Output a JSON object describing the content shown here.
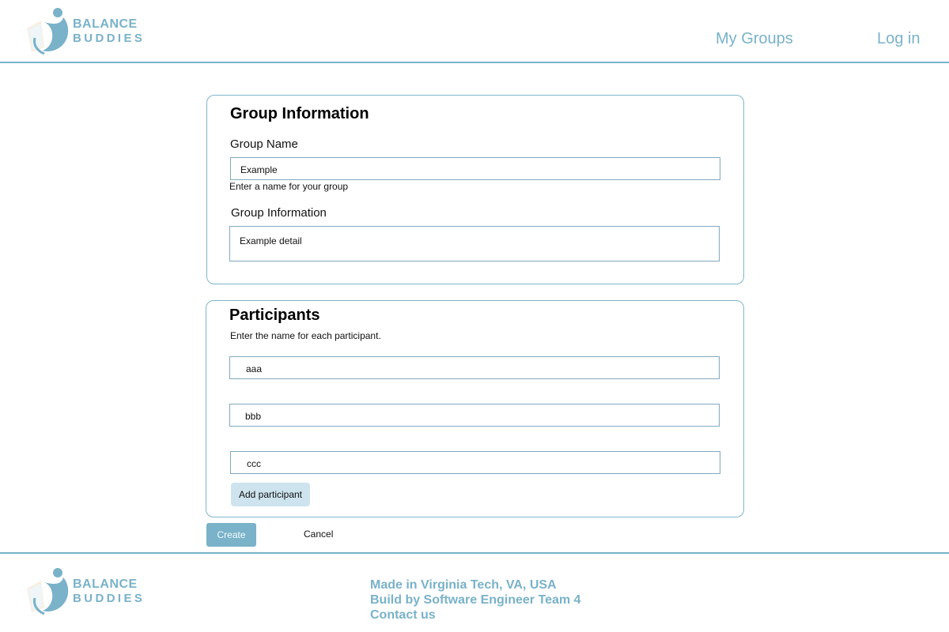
{
  "header": {
    "logo": {
      "line1": "BALANCE",
      "line2": "BUDDIES"
    },
    "nav": {
      "my_groups": "My Groups",
      "login": "Log in"
    }
  },
  "group_info": {
    "title": "Group Information",
    "name_label": "Group Name",
    "name_value": "Example",
    "name_hint": "Enter a name for your group",
    "info_label": "Group Information",
    "info_value": "Example detail"
  },
  "participants": {
    "title": "Participants",
    "instruction": "Enter the name for each  participant.",
    "entries": [
      "aaa",
      "bbb",
      "ccc"
    ],
    "add_label": "Add  participant"
  },
  "actions": {
    "create_label": "Create",
    "cancel_label": "Cancel"
  },
  "footer": {
    "logo": {
      "line1": "BALANCE",
      "line2": "BUDDIES"
    },
    "lines": [
      "Made in Virginia Tech, VA, USA",
      "Build by Software Engineer Team 4",
      "Contact us"
    ]
  },
  "colors": {
    "accent": "#79b2c9",
    "card_border": "#7fb6cb",
    "button_light": "#cde4ee"
  }
}
